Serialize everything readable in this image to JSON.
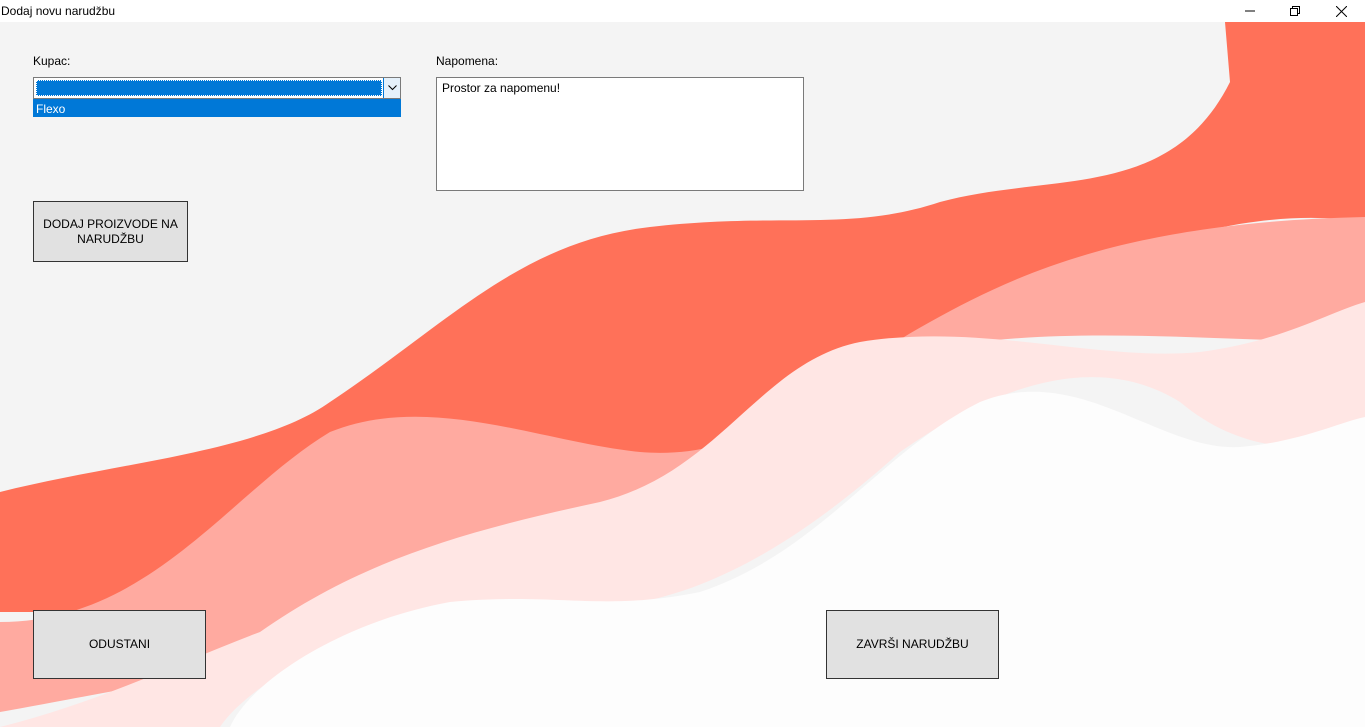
{
  "window": {
    "title": "Dodaj novu narudžbu",
    "controls": [
      "minimize-icon",
      "restore-icon",
      "close-icon"
    ]
  },
  "form": {
    "customer_label": "Kupac:",
    "customer_selected": "",
    "customer_options": [
      "Flexo"
    ],
    "note_label": "Napomena:",
    "note_value": "Prostor za napomenu!"
  },
  "buttons": {
    "add_products": "DODAJ PROIZVODE NA NARUDŽBU",
    "cancel": "ODUSTANI",
    "finish": "ZAVRŠI NARUDŽBU"
  },
  "colors": {
    "accent": "#0078d7",
    "wave_dark": "#ff7159",
    "wave_mid": "#ffaaa0",
    "wave_light": "#ffe6e4",
    "background": "#f4f4f4",
    "button": "#e1e1e1"
  }
}
